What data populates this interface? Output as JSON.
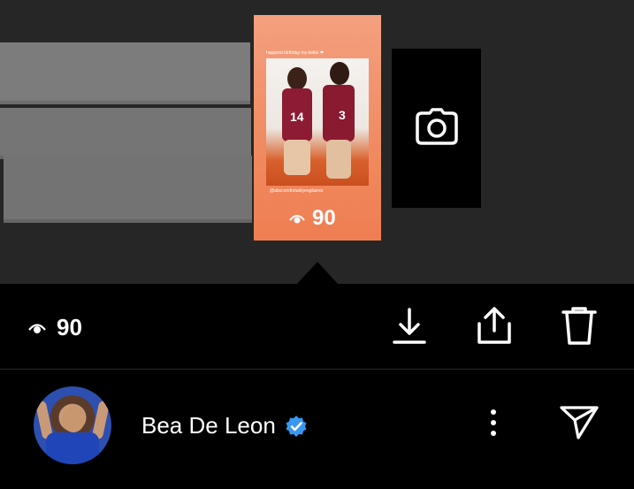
{
  "story": {
    "caption": "happiest birthday my bella! ❤",
    "jersey_left": "14",
    "jersey_right": "3",
    "handle": "@abscomfortablyengilaires",
    "views": "90"
  },
  "icons": {
    "eye": "eye-icon",
    "camera": "camera-icon",
    "download": "download-icon",
    "share": "share-icon",
    "delete": "trash-icon",
    "verified": "verified-badge-icon",
    "more": "more-vertical-icon",
    "send": "send-icon"
  },
  "action_bar": {
    "views": "90"
  },
  "profile": {
    "name": "Bea De Leon",
    "verified_color": "#3897f0"
  }
}
